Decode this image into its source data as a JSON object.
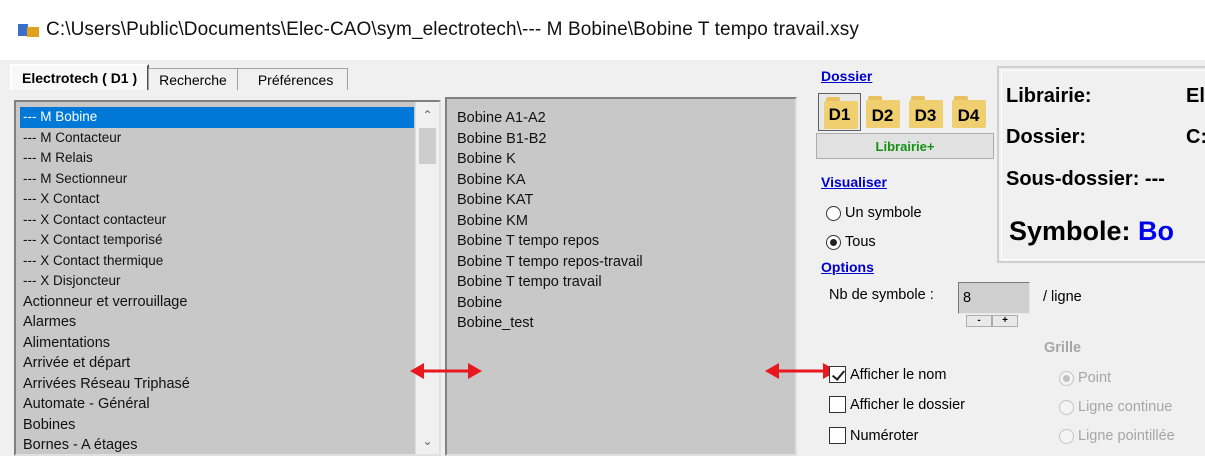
{
  "window": {
    "title": "C:\\Users\\Public\\Documents\\Elec-CAO\\sym_electrotech\\--- M Bobine\\Bobine T tempo travail.xsy"
  },
  "tabs": [
    {
      "label": "Electrotech ( D1 )"
    },
    {
      "label": "Recherche"
    },
    {
      "label": "Préférences"
    }
  ],
  "categories": {
    "selected_index": 0,
    "items": [
      "--- M Bobine",
      "--- M Contacteur",
      "--- M Relais",
      "--- M Sectionneur",
      "--- X Contact",
      "--- X Contact contacteur",
      "--- X Contact temporisé",
      "--- X Contact thermique",
      "--- X Disjoncteur",
      "Actionneur et verrouillage",
      "Alarmes",
      "Alimentations",
      "Arrivée et départ",
      "Arrivées Réseau Triphasé",
      "Automate - Général",
      "Bobines",
      "Bornes - A étages"
    ]
  },
  "symbols": {
    "items": [
      "Bobine A1-A2",
      "Bobine B1-B2",
      "Bobine K",
      "Bobine KA",
      "Bobine KAT",
      "Bobine KM",
      "Bobine T tempo repos",
      "Bobine T tempo repos-travail",
      "Bobine T tempo travail",
      "Bobine",
      "Bobine_test"
    ]
  },
  "dossier": {
    "heading": "Dossier",
    "buttons": [
      "D1",
      "D2",
      "D3",
      "D4"
    ],
    "librairie_label": "Librairie+"
  },
  "visualiser": {
    "heading": "Visualiser",
    "un_symbole": "Un symbole",
    "tous": "Tous",
    "selected": "Tous"
  },
  "options": {
    "heading": "Options",
    "nb_label": "Nb de symbole :",
    "nb_value": "8",
    "per_line": "/ ligne",
    "minus": "-",
    "plus": "+",
    "afficher_nom": "Afficher le nom",
    "afficher_nom_checked": true,
    "afficher_dossier": "Afficher le dossier",
    "afficher_dossier_checked": false,
    "numeroter": "Numéroter",
    "numeroter_checked": false
  },
  "grille": {
    "heading": "Grille",
    "point": "Point",
    "ligne_continue": "Ligne continue",
    "ligne_pointillee": "Ligne pointillée",
    "selected": "Point"
  },
  "info": {
    "librairie_label": "Librairie:",
    "librairie_value": "El",
    "dossier_label": "Dossier:",
    "dossier_value": "C:",
    "sous_dossier_label": "Sous-dossier:",
    "sous_dossier_value": "---",
    "symbole_label": "Symbole:",
    "symbole_value": "Bo"
  },
  "colors": {
    "selection": "#0078d7",
    "link": "#0000cc",
    "arrow": "#e8191e",
    "librairie_green": "#129212",
    "symbole_blue": "#0000ee"
  }
}
